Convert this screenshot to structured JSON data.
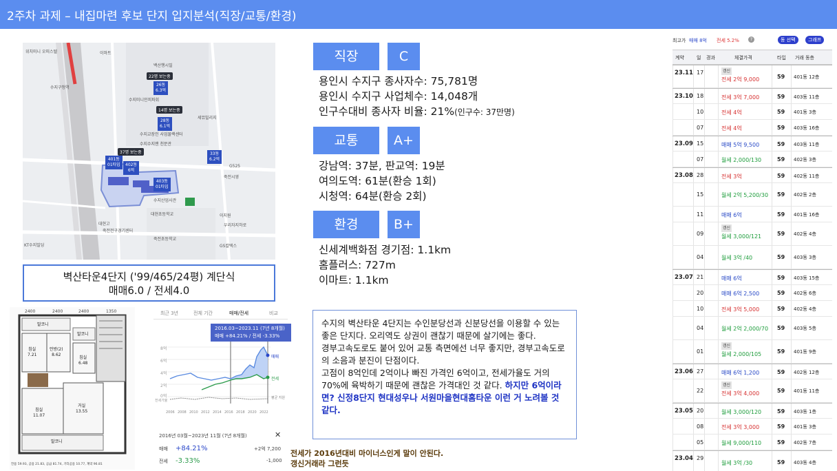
{
  "title": "2주차 과제 – 내집마련 후보 단지 입지분석(직장/교통/환경)",
  "map": {
    "labels": [
      "위치미니 오피스텔",
      "이마트",
      "백산행시빌",
      "수지구청역",
      "세뮤빌리지",
      "수지교장인 사업물랙센터",
      "수지미니인피파회",
      "수지수지맨 천문관",
      "이지원",
      "대현초등학교",
      "수지산업사관",
      "죽전시영",
      "G525",
      "죽전전구경기센터",
      "죽전초등학교",
      "GS칼텍스",
      "대현고",
      "KT수지빌딩",
      "우리자지하로"
    ],
    "tags": [
      "22명 보는중",
      "14명 보는중",
      "37명 보는중"
    ],
    "pins": [
      {
        "title": "26동",
        "value": "6.3억"
      },
      {
        "title": "28동",
        "value": "6.1억"
      },
      {
        "title": "33동",
        "value": "6.2억"
      },
      {
        "title": "401동",
        "value": "01타입"
      },
      {
        "title": "402동",
        "value": "6억"
      },
      {
        "title": "403동",
        "value": "01타입"
      }
    ]
  },
  "caption": {
    "line1": "벽산타운4단지 ('99/465/24평) 계단식",
    "line2": "매매6.0 / 전세4.0"
  },
  "floorplan": {
    "dims": [
      "2400",
      "2400",
      "2400",
      "1350"
    ],
    "rooms": [
      {
        "name": "발코니",
        "size": ""
      },
      {
        "name": "발코니",
        "size": ""
      },
      {
        "name": "침실",
        "size": "7.21"
      },
      {
        "name": "안방(2)",
        "size": "8.62"
      },
      {
        "name": "침실",
        "size": "6.48"
      },
      {
        "name": "거실",
        "size": "13.55"
      },
      {
        "name": "침실",
        "size": "11.07"
      },
      {
        "name": "발코니",
        "size": ""
      }
    ],
    "footer": "전용 59.93, 공용 21.83, 공급 81.74, 기타공용 10.77, 계약 96.81"
  },
  "price_chart": {
    "tabs": [
      "최근 3년",
      "전체 기간",
      "매매/전세",
      "비교"
    ],
    "active_tab": "매매/전세",
    "tooltip_line1": "2016.03~2023.11 (7년 8개월)",
    "tooltip_line2": "매매 +84.21% / 전세 -3.33%",
    "y_ticks": [
      "8억",
      "6억",
      "4억",
      "2억",
      "0억",
      "전세가율"
    ],
    "right_labels": [
      "매매",
      "전세",
      "평균 지원"
    ],
    "x_ticks": [
      "2006",
      "2008",
      "2010",
      "2012",
      "2014",
      "2016",
      "2018",
      "2020",
      "2022"
    ],
    "period": "2016년 03월~2023년 11월 (7년 8개월)",
    "sale_label": "매매",
    "sale_change": "+84.21%",
    "sale_amount": "+2억 7,200",
    "jeonse_label": "전세",
    "jeonse_change": "-3.33%",
    "jeonse_amount": "-1,000",
    "close_icon": "close-icon"
  },
  "sections": [
    {
      "label": "직장",
      "grade": "C",
      "lines": [
        "용인시 수지구 종사자수: 75,781명",
        "용인시 수지구 사업체수: 14,048개",
        "인구수대비 종사자 비율: 21%"
      ],
      "note": "(인구수: 37만명)"
    },
    {
      "label": "교통",
      "grade": "A+",
      "lines": [
        "강남역: 37분, 판교역: 19분",
        "여의도역: 61분(환승 1회)",
        "시청역: 64분(환승 2회)"
      ]
    },
    {
      "label": "환경",
      "grade": "B+",
      "lines": [
        "신세계백화점 경기점: 1.1km",
        "홈플러스: 727m",
        "이마트: 1.1km"
      ]
    }
  ],
  "comment": {
    "p1": "수지의 벽산타운 4단지는 수인분당선과 신분당선을 이용할 수 있는 좋은 단지다. 오리역도 상권이 괜찮기 때문에 살기에는 좋다.",
    "p2": "경부고속도로도 붙어 있어 교통 측면에선 너무 좋지만, 경부고속도로의 소음과 분진이 단점이다.",
    "p3": "고점이 8억인데 2억이나 빠진 가격인 6억이고, 전세가율도 거의 70%에 육박하기 때문에 괜찮은 가격대인 것 같다.",
    "p3_bold": "하지만 6억이라면? 신정8단지 현대성우나 서원마을현대홈타운 이런 거 노려볼 것 같다."
  },
  "notes": [
    "전세가 2016년대비 마이너스인게 말이 안된다.",
    "갱신거래라 그런듯"
  ],
  "deals": {
    "summary_label": "최고가",
    "summary_sale": "매매 8억",
    "summary_jeonse": "전세 5.2%",
    "button_dong": "동 선택",
    "button_graph": "그래프",
    "headers": [
      "계약",
      "일",
      "경과",
      "체결가격",
      "타입",
      "거래 동층"
    ],
    "rows": [
      {
        "month": "23.11",
        "day": "17",
        "renew": true,
        "price": "전세 2억 9,000",
        "kind": "red",
        "type": "59",
        "dong": "401동 12층"
      },
      {
        "month": "23.10",
        "day": "18",
        "renew": false,
        "price": "전세 3억 7,000",
        "kind": "red",
        "type": "59",
        "dong": "403동 11층"
      },
      {
        "month": "",
        "day": "10",
        "renew": false,
        "price": "전세 4억",
        "kind": "red",
        "type": "59",
        "dong": "401동 3층"
      },
      {
        "month": "",
        "day": "07",
        "renew": false,
        "price": "전세 4억",
        "kind": "red",
        "type": "59",
        "dong": "403동 16층"
      },
      {
        "month": "23.09",
        "day": "15",
        "renew": false,
        "price": "매매 5억 9,500",
        "kind": "blue",
        "type": "59",
        "dong": "403동 11층"
      },
      {
        "month": "",
        "day": "07",
        "renew": false,
        "price": "월세 2,000/130",
        "kind": "green",
        "type": "59",
        "dong": "402동 3층"
      },
      {
        "month": "23.08",
        "day": "28",
        "renew": false,
        "price": "전세 3억",
        "kind": "red",
        "type": "59",
        "dong": "402동 11층"
      },
      {
        "month": "",
        "day": "15",
        "renew": false,
        "price": "월세 2억 5,200/30",
        "kind": "green",
        "type": "59",
        "dong": "402동 2층"
      },
      {
        "month": "",
        "day": "11",
        "renew": false,
        "price": "매매 6억",
        "kind": "blue",
        "type": "59",
        "dong": "401동 16층"
      },
      {
        "month": "",
        "day": "09",
        "renew": true,
        "price": "월세 3,000/121",
        "kind": "green",
        "type": "59",
        "dong": "402동 4층"
      },
      {
        "month": "",
        "day": "04",
        "renew": false,
        "price": "월세 3억 /40",
        "kind": "green",
        "type": "59",
        "dong": "403동 3층"
      },
      {
        "month": "23.07",
        "day": "21",
        "renew": false,
        "price": "매매 6억",
        "kind": "blue",
        "type": "59",
        "dong": "403동 15층"
      },
      {
        "month": "",
        "day": "20",
        "renew": false,
        "price": "매매 6억 2,500",
        "kind": "blue",
        "type": "59",
        "dong": "402동 6층"
      },
      {
        "month": "",
        "day": "10",
        "renew": false,
        "price": "전세 3억 5,000",
        "kind": "red",
        "type": "59",
        "dong": "402동 4층"
      },
      {
        "month": "",
        "day": "04",
        "renew": false,
        "price": "월세 2억 2,000/70",
        "kind": "green",
        "type": "59",
        "dong": "403동 5층"
      },
      {
        "month": "",
        "day": "01",
        "renew": true,
        "price": "월세 2,000/105",
        "kind": "green",
        "type": "59",
        "dong": "401동 9층"
      },
      {
        "month": "23.06",
        "day": "27",
        "renew": false,
        "price": "매매 6억 1,200",
        "kind": "blue",
        "type": "59",
        "dong": "402동 12층"
      },
      {
        "month": "",
        "day": "22",
        "renew": true,
        "price": "전세 3억 4,000",
        "kind": "red",
        "type": "59",
        "dong": "401동 11층"
      },
      {
        "month": "23.05",
        "day": "20",
        "renew": false,
        "price": "월세 3,000/120",
        "kind": "green",
        "type": "59",
        "dong": "403동 1층"
      },
      {
        "month": "",
        "day": "08",
        "renew": false,
        "price": "전세 3억 3,000",
        "kind": "red",
        "type": "59",
        "dong": "401동 3층"
      },
      {
        "month": "",
        "day": "05",
        "renew": false,
        "price": "월세 9,000/110",
        "kind": "green",
        "type": "59",
        "dong": "402동 7층"
      },
      {
        "month": "23.04",
        "day": "29",
        "renew": false,
        "price": "월세 3억 /30",
        "kind": "green",
        "type": "59",
        "dong": "403동 4층"
      }
    ]
  }
}
